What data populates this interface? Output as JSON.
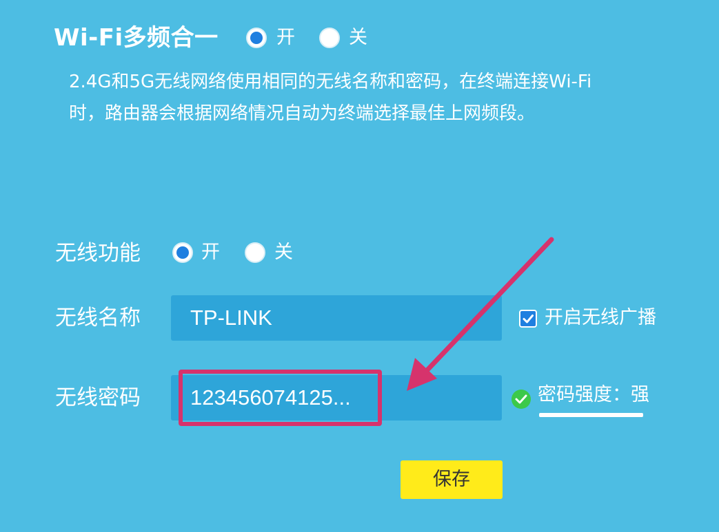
{
  "header": {
    "title": "Wi-Fi多频合一",
    "options": [
      {
        "label": "开",
        "checked": true
      },
      {
        "label": "关",
        "checked": false
      }
    ]
  },
  "description": "2.4G和5G无线网络使用相同的无线名称和密码，在终端连接Wi-Fi时，路由器会根据网络情况自动为终端选择最佳上网频段。",
  "wireless_function": {
    "label": "无线功能",
    "options": [
      {
        "label": "开",
        "checked": true
      },
      {
        "label": "关",
        "checked": false
      }
    ]
  },
  "wireless_name": {
    "label": "无线名称",
    "value": "TP-LINK",
    "broadcast_label": "开启无线广播",
    "broadcast_checked": true
  },
  "wireless_password": {
    "label": "无线密码",
    "value": "123456074125...",
    "strength_label": "密码强度：强"
  },
  "save_label": "保存",
  "colors": {
    "background": "#4dbde3",
    "input_bg": "#2ea5d9",
    "radio_selected": "#1f7fe0",
    "save_button": "#ffeb1a",
    "annotation": "#d6336c",
    "strength_ok": "#3cc94a"
  }
}
